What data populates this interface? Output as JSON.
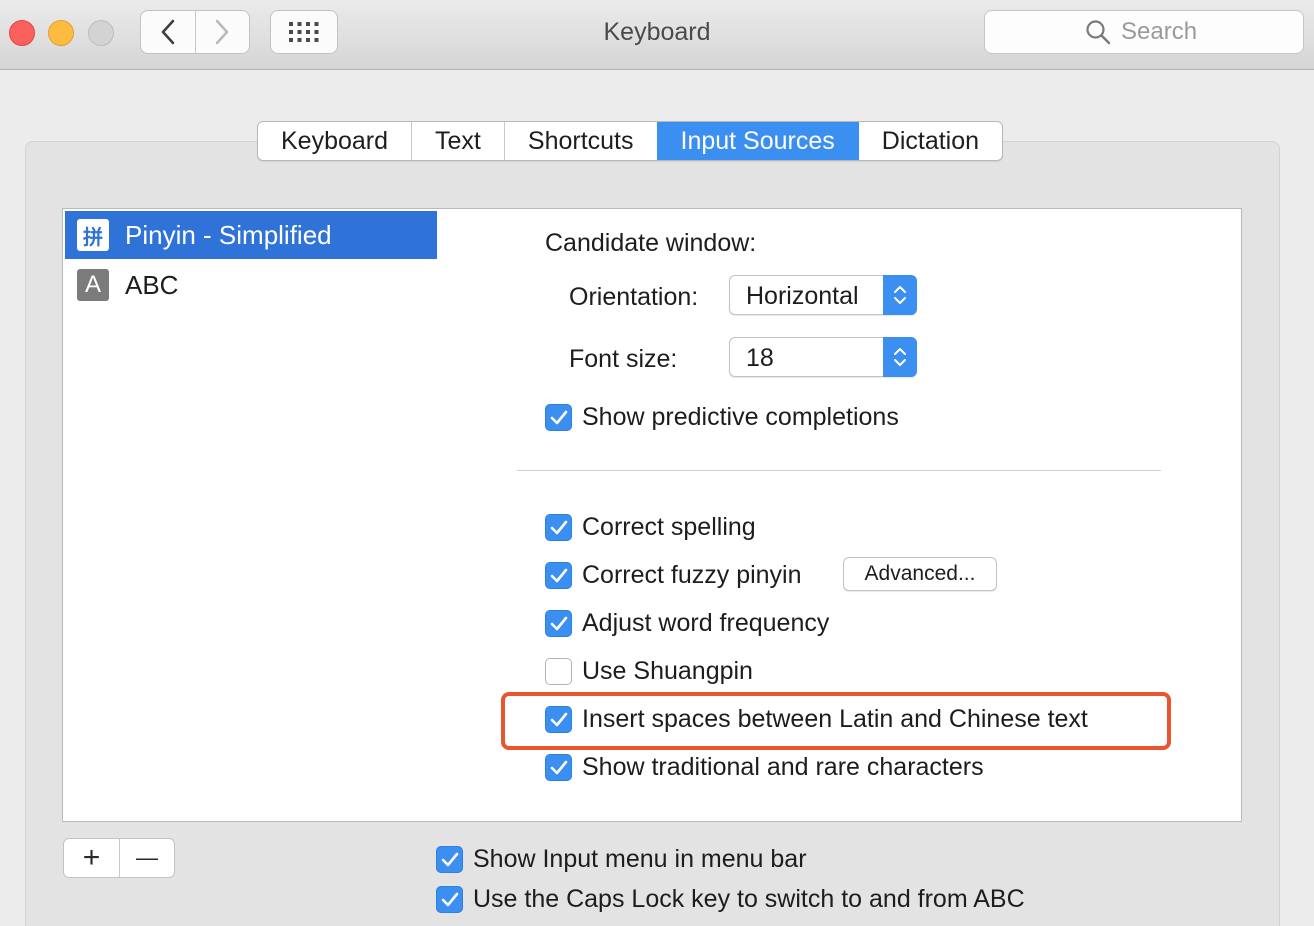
{
  "window": {
    "title": "Keyboard"
  },
  "search": {
    "placeholder": "Search"
  },
  "tabs": [
    {
      "label": "Keyboard",
      "active": false
    },
    {
      "label": "Text",
      "active": false
    },
    {
      "label": "Shortcuts",
      "active": false
    },
    {
      "label": "Input Sources",
      "active": true
    },
    {
      "label": "Dictation",
      "active": false
    }
  ],
  "sources": [
    {
      "icon_glyph": "拼",
      "label": "Pinyin - Simplified",
      "selected": true
    },
    {
      "icon_glyph": "A",
      "label": "ABC",
      "selected": false
    }
  ],
  "candidate": {
    "heading": "Candidate window:",
    "orientation_label": "Orientation:",
    "orientation_value": "Horizontal",
    "font_size_label": "Font size:",
    "font_size_value": "18"
  },
  "options": {
    "predictive": {
      "label": "Show predictive completions",
      "checked": true
    },
    "correct_spelling": {
      "label": "Correct spelling",
      "checked": true
    },
    "fuzzy_pinyin": {
      "label": "Correct fuzzy pinyin",
      "checked": true
    },
    "advanced_label": "Advanced...",
    "word_frequency": {
      "label": "Adjust word frequency",
      "checked": true
    },
    "shuangpin": {
      "label": "Use Shuangpin",
      "checked": false
    },
    "insert_spaces": {
      "label": "Insert spaces between Latin and Chinese text",
      "checked": true
    },
    "traditional": {
      "label": "Show traditional and rare characters",
      "checked": true
    }
  },
  "bottom": {
    "add_label": "+",
    "remove_label": "—",
    "show_input_menu": {
      "label": "Show Input menu in menu bar",
      "checked": true
    },
    "caps_lock": {
      "label": "Use the Caps Lock key to switch to and from ABC",
      "checked": true
    }
  },
  "colors": {
    "accent": "#3b8ff0",
    "selection": "#2f73d8",
    "highlight_box": "#e9552f"
  }
}
